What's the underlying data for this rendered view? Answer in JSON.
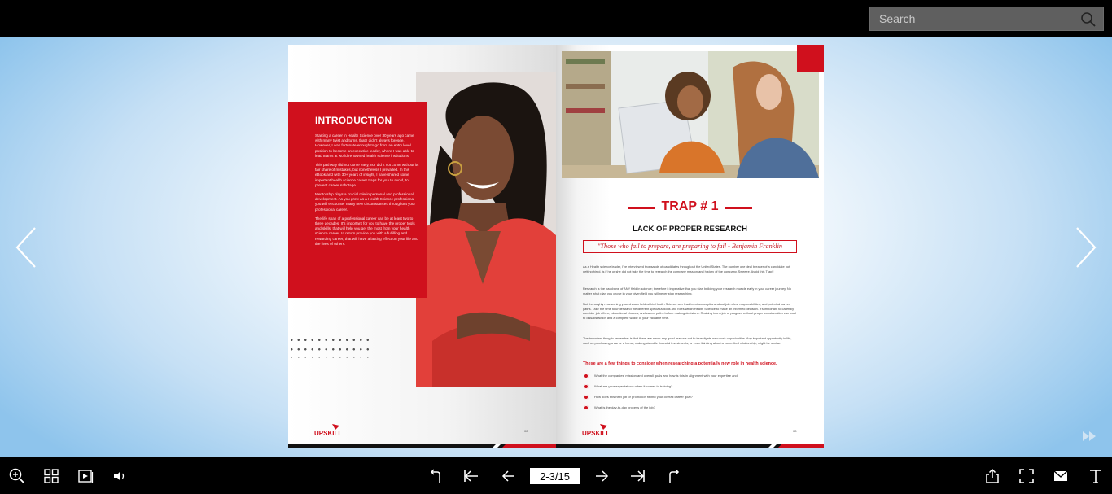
{
  "search": {
    "placeholder": "Search"
  },
  "viewer": {
    "current_page": "2-3/15"
  },
  "left_page": {
    "intro_title": "INTRODUCTION",
    "paragraphs": [
      "Starting a career in Health Science over 30 years ago came with many twist and turns, that I didn't always foresee. However, I was fortunate enough to go from an entry level position to become an executive leader, where I was able to lead teams at world renowned health science institutions.",
      "This pathway did not come easy, nor did it not come without its fair share of mistakes, but nonetheless I prevailed. In this eBook and with 30+ years of insight, I have shared some important health science career traps for you to avoid, to prevent career sabotage.",
      "Mentorship plays a crucial role in personal and professional development. As you grow as a Health Science professional you will encounter many new circumstances throughout your professional career.",
      "The life span of a professional career can be at least two to three decades. It's important for you to have the proper tools and skills, that will help you get the most from your health science career. In return provide you with a fulfilling and rewarding career, that will have a lasting effect on your life and the lives of others."
    ],
    "logo_text": "UPSKILL",
    "page_number": "02"
  },
  "right_page": {
    "trap_title": "TRAP # 1",
    "subtitle": "LACK OF PROPER RESEARCH",
    "quote": "\"Those who fail to prepare, are preparing to fail - Benjamin Franklin",
    "paragraphs": [
      "As a Health science leader, I've interviewed thousands of candidates throughout the United States. The number one deal breaker of a candidate not getting hired, is if he or she did not take the time to research the company mission and history of the company. Sweeee, Avoid this Trap!!",
      "Research is the backbone of ANY field in science; therefore it imperative that you start building your research muscle early in your career journey. No matter what plan you chose in your given field you will never stop researching.",
      "Not thoroughly researching your chosen field within Health Science can lead to misconceptions about job roles, responsibilities, and potential career paths. Take the time to understand the different specializations and roles within Health Science to make an informed decision. It's important to carefully consider job offers, educational choices, and career paths before making decisions. Rushing into a job or program without proper consideration can lead to dissatisfaction and a complete waste of your valuable time.",
      "The important thing to remember is that there are never any good reasons not to investigate new work opportunities. Any important opportunity in life, such as purchasing a car or a home, making sizeable financial investments, or even thinking about a committed relationship, might be similar."
    ],
    "consider_heading": "These are a few things to consider when researching a potentially new role in health science.",
    "bullets": [
      "What the companies' mission and overall goals and how is this in alignment with your expertise and",
      "What are your expectations when it comes to training?",
      "How does this next job or promotion fit into your overall career goal?",
      "What is the day-to-day process of the job?"
    ],
    "logo_text": "UPSKILL",
    "page_number": "03"
  },
  "colors": {
    "accent": "#d0101d",
    "toolbar": "#000000",
    "search_bg": "#5f5f5f"
  },
  "icons": {
    "top": [
      "search-icon"
    ],
    "stage": [
      "chevron-left-icon",
      "chevron-right-icon",
      "fast-forward-icon"
    ],
    "bottom_left": [
      "zoom-in-icon",
      "thumbnails-icon",
      "autoplay-icon",
      "sound-icon"
    ],
    "bottom_center": [
      "first-page-curl-icon",
      "first-page-icon",
      "previous-page-icon",
      "next-page-icon",
      "last-page-icon",
      "last-page-curl-icon"
    ],
    "bottom_right": [
      "share-icon",
      "fullscreen-icon",
      "email-icon",
      "text-icon"
    ]
  }
}
